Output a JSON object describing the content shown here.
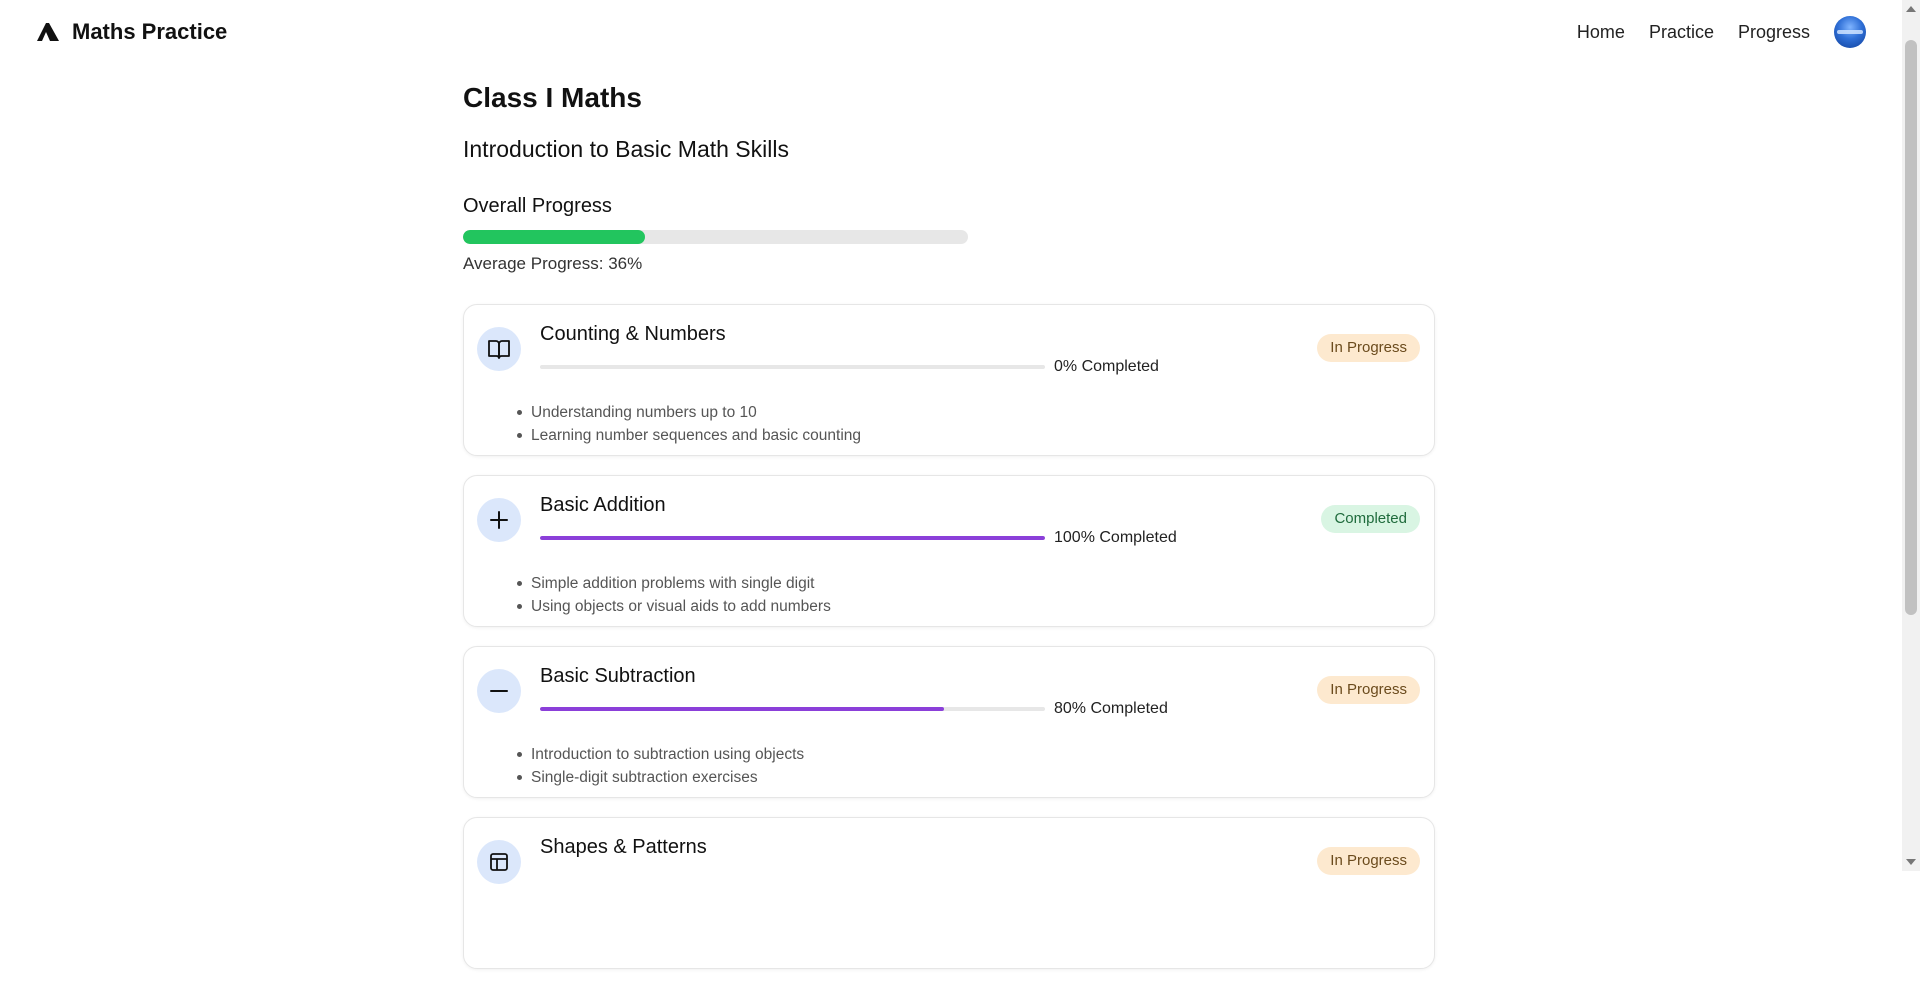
{
  "header": {
    "brand": "Maths Practice",
    "nav": [
      "Home",
      "Practice",
      "Progress"
    ]
  },
  "page": {
    "title": "Class I Maths",
    "subtitle": "Introduction to Basic Math Skills",
    "overall_label": "Overall Progress",
    "overall_progress": 36,
    "average_text": "Average Progress: 36%"
  },
  "colors": {
    "overall_fill": "#22c55e",
    "topic_fill": "#8b3fd9",
    "icon_bg": "#dbe7fb",
    "in_progress_bg": "#fde9cf",
    "completed_bg": "#d9f5e3"
  },
  "topics": [
    {
      "title": "Counting & Numbers",
      "icon": "book-open-icon",
      "progress": 0,
      "percent_text": "0% Completed",
      "status": "In Progress",
      "status_type": "inprogress",
      "points": [
        "Understanding numbers up to 10",
        "Learning number sequences and basic counting"
      ]
    },
    {
      "title": "Basic Addition",
      "icon": "plus-icon",
      "progress": 100,
      "percent_text": "100% Completed",
      "status": "Completed",
      "status_type": "completed",
      "points": [
        "Simple addition problems with single digit",
        "Using objects or visual aids to add numbers"
      ]
    },
    {
      "title": "Basic Subtraction",
      "icon": "minus-icon",
      "progress": 80,
      "percent_text": "80% Completed",
      "status": "In Progress",
      "status_type": "inprogress",
      "points": [
        "Introduction to subtraction using objects",
        "Single-digit subtraction exercises"
      ]
    },
    {
      "title": "Shapes & Patterns",
      "icon": "layout-icon",
      "progress": 0,
      "percent_text": "",
      "status": "In Progress",
      "status_type": "inprogress",
      "points": []
    }
  ]
}
